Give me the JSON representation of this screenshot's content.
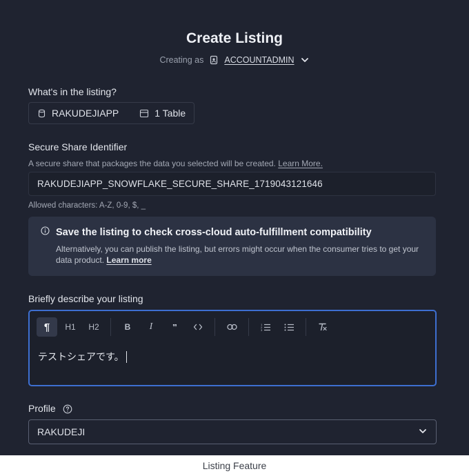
{
  "page": {
    "title": "Create Listing",
    "creating_as_label": "Creating as",
    "account": "ACCOUNTADMIN",
    "caption": "Listing Feature"
  },
  "listing_contents": {
    "label": "What's in the listing?",
    "database": "RAKUDEJIAPP",
    "tables": "1 Table"
  },
  "share": {
    "label": "Secure Share Identifier",
    "description": "A secure share that packages the data you selected will be created.",
    "learn_more": "Learn More.",
    "value": "RAKUDEJIAPP_SNOWFLAKE_SECURE_SHARE_1719043121646",
    "allowed": "Allowed characters: A-Z, 0-9, $, _"
  },
  "callout": {
    "title": "Save the listing to check cross-cloud auto-fulfillment compatibility",
    "body": "Alternatively, you can publish the listing, but errors might occur when the consumer tries to get your data product.",
    "link": "Learn more"
  },
  "description": {
    "label": "Briefly describe your listing",
    "toolbar": {
      "paragraph": "¶",
      "h1": "H1",
      "h2": "H2",
      "bold": "B",
      "italic": "I",
      "quote": "❜❜"
    },
    "text": "テストシェアです。"
  },
  "profile": {
    "label": "Profile",
    "value": "RAKUDEJI"
  },
  "colors": {
    "background": "#1f2330",
    "accent": "#3d6fd1",
    "callout": "#2c3243"
  }
}
